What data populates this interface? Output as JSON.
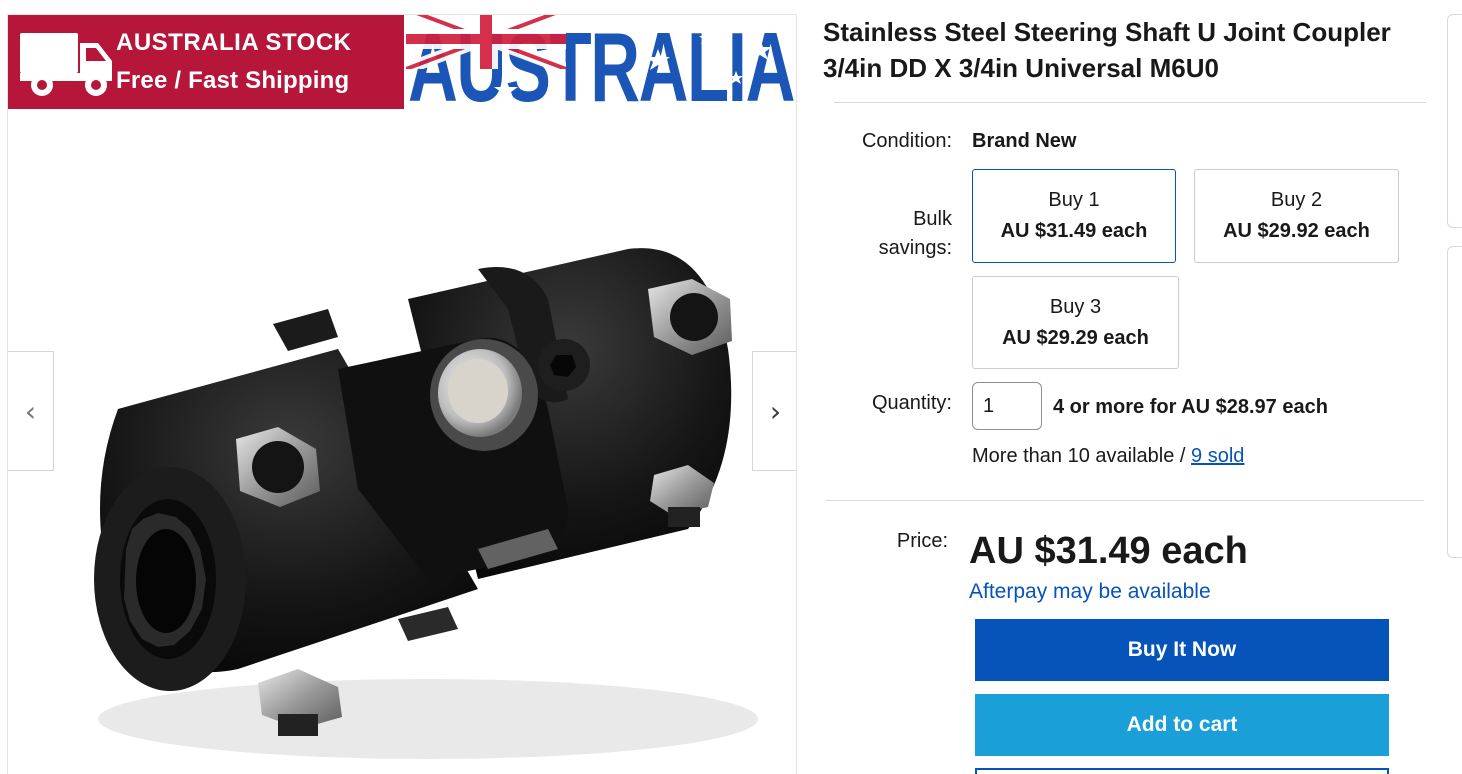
{
  "banner": {
    "stock_text": "AUSTRALIA STOCK",
    "shipping_text": "Free / Fast Shipping",
    "country_word": "AUSTRALIA"
  },
  "gallery": {
    "prev_icon": "chevron-left-icon",
    "next_icon": "chevron-right-icon",
    "product_image": "steering-shaft-u-joint-photo"
  },
  "listing": {
    "title": "Stainless Steel Steering Shaft U Joint Coupler 3/4in DD X 3/4in Universal M6U0",
    "condition_label": "Condition:",
    "condition_value": "Brand New",
    "bulk_label_line1": "Bulk",
    "bulk_label_line2": "savings:",
    "bulk_options": [
      {
        "qty": "Buy 1",
        "price": "AU $31.49 each",
        "selected": true
      },
      {
        "qty": "Buy 2",
        "price": "AU $29.92 each",
        "selected": false
      },
      {
        "qty": "Buy 3",
        "price": "AU $29.29 each",
        "selected": false
      }
    ],
    "quantity_label": "Quantity:",
    "quantity_value": "1",
    "quantity_note": "4 or more for AU $28.97 each",
    "available_text": "More than 10 available /",
    "sold_link": "9 sold",
    "price_label": "Price:",
    "price_value": "AU $31.49 each",
    "afterpay_text": "Afterpay may be available",
    "buy_now_label": "Buy It Now",
    "add_to_cart_label": "Add to cart"
  },
  "colors": {
    "banner_red": "#b5163a",
    "australia_blue": "#1b55b5",
    "primary_button": "#0654ba",
    "cart_button": "#1a9fd8",
    "link": "#0654ba"
  }
}
